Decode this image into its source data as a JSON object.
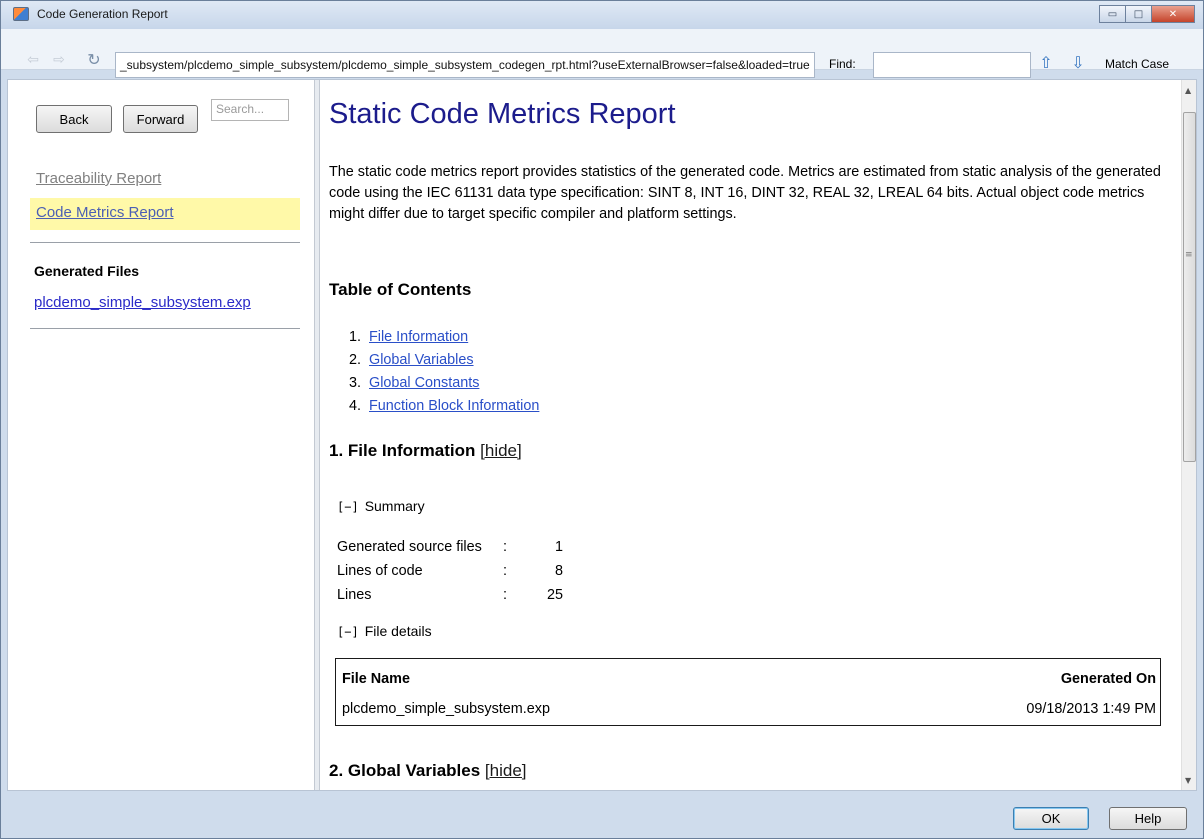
{
  "window": {
    "title": "Code Generation Report",
    "minimize_glyph": "▭",
    "maximize_glyph": "□",
    "close_glyph": "✕"
  },
  "toolbar": {
    "back_arrow": "⇦",
    "forward_arrow": "⇨",
    "refresh_glyph": "↻",
    "url": "_subsystem/plcdemo_simple_subsystem/plcdemo_simple_subsystem_codegen_rpt.html?useExternalBrowser=false&loaded=true",
    "find_label": "Find:",
    "find_value": "",
    "find_up_glyph": "⇧",
    "find_down_glyph": "⇩",
    "match_case_label": "Match Case"
  },
  "sidebar": {
    "back_label": "Back",
    "forward_label": "Forward",
    "search_placeholder": "Search...",
    "nav": [
      {
        "label": "Traceability Report"
      },
      {
        "label": "Code Metrics Report"
      }
    ],
    "generated_files_heading": "Generated Files",
    "files": [
      "plcdemo_simple_subsystem.exp"
    ],
    "highlight_color": "#fff9a8"
  },
  "report": {
    "title": "Static Code Metrics Report",
    "intro": "The static code metrics report provides statistics of the generated code. Metrics are estimated from static analysis of the generated code using the IEC 61131 data type specification: SINT 8, INT 16, DINT 32, REAL 32, LREAL 64 bits. Actual object code metrics might differ due to target specific compiler and platform settings.",
    "toc_heading": "Table of Contents",
    "toc": [
      {
        "num": "1.",
        "label": "File Information"
      },
      {
        "num": "2.",
        "label": "Global Variables"
      },
      {
        "num": "3.",
        "label": "Global Constants"
      },
      {
        "num": "4.",
        "label": "Function Block Information"
      }
    ],
    "section1_title": "1. File Information",
    "hide_label": "[hide]",
    "summary_toggle": "[−]",
    "summary_label": "Summary",
    "summary": [
      {
        "label": "Generated source files",
        "colon": ":",
        "value": "1"
      },
      {
        "label": "Lines of code",
        "colon": ":",
        "value": "8"
      },
      {
        "label": "Lines",
        "colon": ":",
        "value": "25"
      }
    ],
    "details_toggle": "[−]",
    "details_label": "File details",
    "file_table": {
      "col_name": "File Name",
      "col_generated": "Generated On",
      "rows": [
        {
          "name": "plcdemo_simple_subsystem.exp",
          "generated": "09/18/2013 1:49 PM"
        }
      ]
    },
    "section2_title": "2. Global Variables",
    "title_color": "#1c1c8c",
    "link_color": "#2a4fc8"
  },
  "scrollbar": {
    "up_glyph": "▲",
    "down_glyph": "▼",
    "grip_glyph": "≡"
  },
  "dialog": {
    "ok_label": "OK",
    "help_label": "Help"
  }
}
